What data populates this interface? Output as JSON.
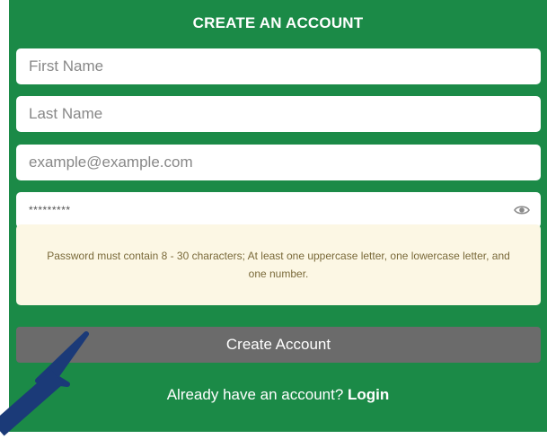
{
  "form": {
    "title": "CREATE AN ACCOUNT",
    "first_name_placeholder": "First Name",
    "last_name_placeholder": "Last Name",
    "email_placeholder": "example@example.com",
    "password_value": "*********",
    "password_toggle_icon": "eye-icon",
    "password_hint": "Password must contain 8 - 30 characters; At least one uppercase letter, one lowercase letter, and one number.",
    "submit_label": "Create Account",
    "login_prompt": "Already have an account?",
    "login_link": "Login"
  },
  "colors": {
    "panel_bg": "#1b8a47",
    "notice_bg": "#fcf7e4",
    "button_bg": "#6b6b6b",
    "arrow": "#1b3a78"
  },
  "annotation": {
    "arrow_icon": "pointer-arrow-icon"
  }
}
